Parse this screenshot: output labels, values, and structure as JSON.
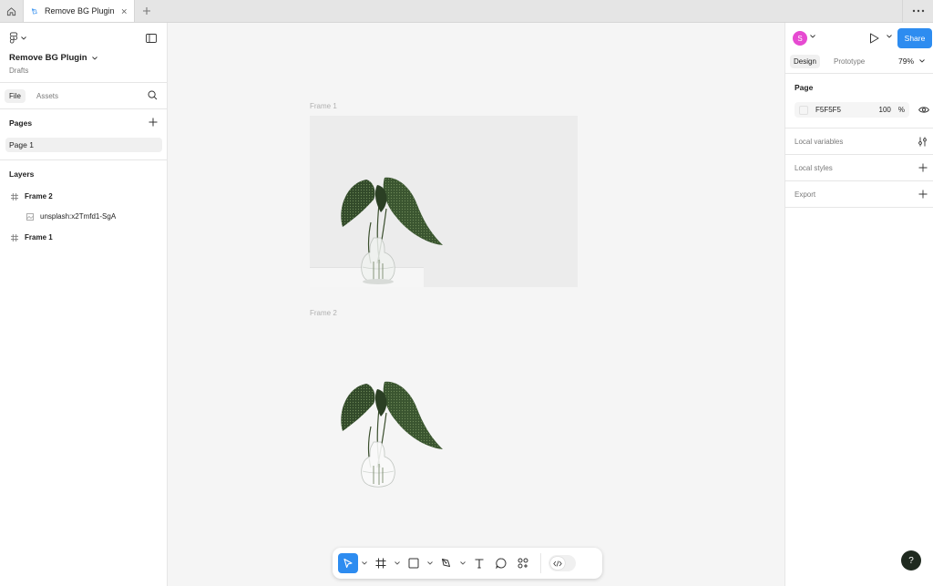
{
  "tabbar": {
    "tab_title": "Remove BG Plugin"
  },
  "left_panel": {
    "file_title": "Remove BG Plugin",
    "file_location": "Drafts",
    "tabs": [
      {
        "label": "File"
      },
      {
        "label": "Assets"
      }
    ],
    "pages_title": "Pages",
    "pages": [
      {
        "label": "Page 1"
      }
    ],
    "layers_title": "Layers",
    "layers": [
      {
        "label": "Frame 2",
        "type": "frame"
      },
      {
        "label": "unsplash:x2Tmfd1-SgA",
        "type": "image"
      },
      {
        "label": "Frame 1",
        "type": "frame"
      }
    ]
  },
  "canvas": {
    "frames": [
      {
        "label": "Frame 1"
      },
      {
        "label": "Frame 2"
      }
    ]
  },
  "right_panel": {
    "avatar_initial": "S",
    "share_label": "Share",
    "tabs": [
      {
        "label": "Design"
      },
      {
        "label": "Prototype"
      }
    ],
    "zoom": "79%",
    "page_section": {
      "title": "Page",
      "color_hex": "F5F5F5",
      "opacity": "100",
      "opacity_unit": "%"
    },
    "rows": [
      {
        "label": "Local variables"
      },
      {
        "label": "Local styles"
      },
      {
        "label": "Export"
      }
    ]
  },
  "help": {
    "label": "?"
  },
  "colors": {
    "accent": "#2d8cf0",
    "avatar": "#e64ad1",
    "page_background": "#F5F5F5"
  }
}
